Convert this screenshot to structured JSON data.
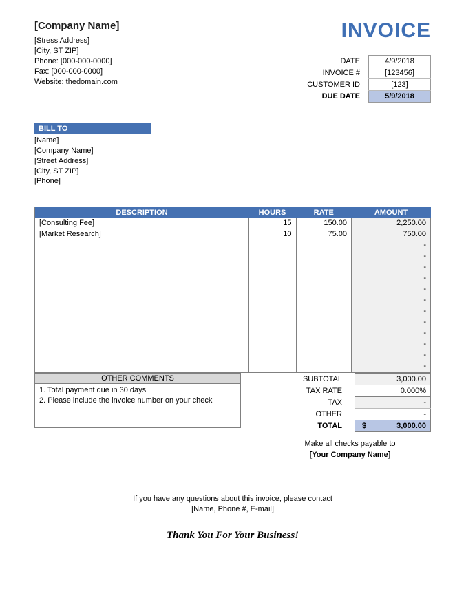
{
  "company": {
    "name": "[Company Name]",
    "address": "[Stress Address]",
    "city_st_zip": "[City, ST ZIP]",
    "phone_label": "Phone: [000-000-0000]",
    "fax_label": "Fax: [000-000-0000]",
    "website_label": "Website: thedomain.com"
  },
  "title": "INVOICE",
  "meta": {
    "date_label": "DATE",
    "date_val": "4/9/2018",
    "invoice_num_label": "INVOICE #",
    "invoice_num_val": "[123456]",
    "customer_id_label": "CUSTOMER ID",
    "customer_id_val": "[123]",
    "due_date_label": "DUE DATE",
    "due_date_val": "5/9/2018"
  },
  "billto": {
    "header": "BILL TO",
    "name": "[Name]",
    "company": "[Company Name]",
    "address": "[Street Address]",
    "city_st_zip": "[City, ST ZIP]",
    "phone": "[Phone]"
  },
  "items_header": {
    "description": "DESCRIPTION",
    "hours": "HOURS",
    "rate": "RATE",
    "amount": "AMOUNT"
  },
  "items": [
    {
      "description": "[Consulting Fee]",
      "hours": "15",
      "rate": "150.00",
      "amount": "2,250.00"
    },
    {
      "description": "[Market Research]",
      "hours": "10",
      "rate": "75.00",
      "amount": "750.00"
    }
  ],
  "totals": {
    "subtotal_label": "SUBTOTAL",
    "subtotal_val": "3,000.00",
    "taxrate_label": "TAX RATE",
    "taxrate_val": "0.000%",
    "tax_label": "TAX",
    "tax_val": "-",
    "other_label": "OTHER",
    "other_val": "-",
    "total_label": "TOTAL",
    "total_currency": "$",
    "total_val": "3,000.00"
  },
  "comments": {
    "header": "OTHER COMMENTS",
    "line1": "1. Total payment due in 30 days",
    "line2": "2. Please include the invoice number on your check"
  },
  "payable": {
    "line1": "Make all checks payable to",
    "line2": "[Your Company Name]"
  },
  "questions": {
    "line1": "If you have any questions about this invoice, please contact",
    "line2": "[Name, Phone #, E-mail]"
  },
  "thankyou": "Thank You For Your Business!"
}
